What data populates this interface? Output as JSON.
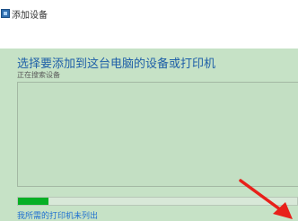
{
  "window": {
    "title": "添加设备"
  },
  "main": {
    "heading": "选择要添加到这台电脑的设备或打印机",
    "status": "正在搜索设备",
    "results": [],
    "progress": 0.11,
    "link_not_listed": "我所需的打印机未列出"
  },
  "annotation": {
    "arrow_color": "#e8201a"
  },
  "colors": {
    "accent": "#1e5fa8",
    "progress": "#06b025"
  }
}
